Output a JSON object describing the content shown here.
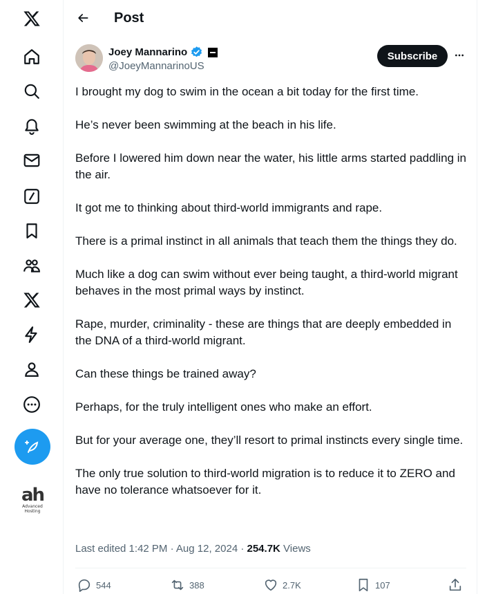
{
  "header": {
    "title": "Post"
  },
  "author": {
    "name": "Joey Mannarino",
    "handle": "@JoeyMannarinoUS"
  },
  "actions": {
    "subscribe_label": "Subscribe"
  },
  "post": {
    "paragraphs": [
      "I brought my dog to swim in the ocean a bit today for the first time.",
      "He’s never been swimming at the beach in his life.",
      "Before I lowered him down near the water, his little arms started paddling in the air.",
      "It got me to thinking about third-world immigrants and rape.",
      "There is a primal instinct in all animals that teach them the things they do.",
      "Much like a dog can swim without ever being taught, a third-world migrant behaves in the most primal ways by instinct.",
      "Rape, murder, criminality - these are things that are deeply embedded in the DNA of a third-world migrant.",
      "Can these things be trained away?",
      "Perhaps, for the truly intelligent ones who make an effort.",
      "But for your average one, they’ll resort to primal instincts every single time.",
      "The only true solution to third-world migration is to reduce it to ZERO and have no tolerance whatsoever for it."
    ],
    "edited": "Last edited 1:42 PM · Aug 12, 2024 · ",
    "views_count": "254.7K",
    "views_label": " Views"
  },
  "stats": {
    "replies": "544",
    "reposts": "388",
    "likes": "2.7K",
    "bookmarks": "107"
  },
  "sidebar_logo": {
    "mark": "ah",
    "line1": "Advanced",
    "line2": "Hosting"
  },
  "colors": {
    "accent": "#1d9bf0",
    "text_primary": "#0f1419",
    "text_secondary": "#536471",
    "border": "#eff3f4"
  },
  "icons": {
    "sidebar": [
      "x-logo-icon",
      "home-icon",
      "search-icon",
      "notifications-bell-icon",
      "messages-envelope-icon",
      "grok-icon",
      "bookmarks-icon",
      "communities-icon",
      "premium-x-icon",
      "verified-orgs-bolt-icon",
      "profile-icon",
      "more-circle-icon",
      "compose-post-icon"
    ],
    "actions": [
      "reply-icon",
      "repost-icon",
      "like-heart-icon",
      "bookmark-icon",
      "share-icon"
    ]
  }
}
